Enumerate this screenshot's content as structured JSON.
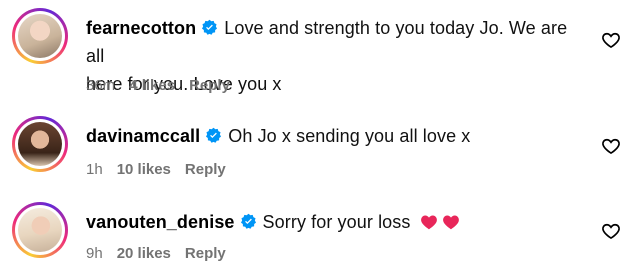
{
  "comments": [
    {
      "username": "fearnecotton",
      "text_line1": "Love and strength to you today Jo. We are all",
      "text_line2": "here for you. Love you x",
      "time": "36m",
      "likes": "4 likes",
      "reply": "Reply"
    },
    {
      "username": "davinamccall",
      "text_line1": "Oh Jo x sending you all love x",
      "time": "1h",
      "likes": "10 likes",
      "reply": "Reply"
    },
    {
      "username": "vanouten_denise",
      "text_line1": "Sorry for your loss",
      "time": "9h",
      "likes": "20 likes",
      "reply": "Reply"
    }
  ],
  "colors": {
    "verified_blue": "#0095f6",
    "meta_gray": "#737373",
    "emoji_heart": "#e8265a"
  },
  "icons": [
    "verified-badge-icon",
    "like-heart-icon",
    "pink-heart-emoji"
  ]
}
